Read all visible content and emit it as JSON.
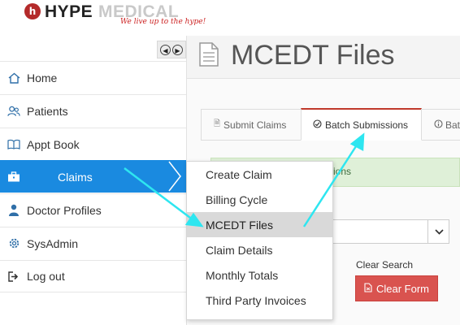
{
  "brand": {
    "logo_letter": "h",
    "name_first": "HYPE",
    "name_second": "MEDICAL",
    "tagline": "We live up to the hype!"
  },
  "sidebar": {
    "items": [
      {
        "label": "Home",
        "icon": "home-icon"
      },
      {
        "label": "Patients",
        "icon": "users-icon"
      },
      {
        "label": "Appt Book",
        "icon": "book-icon"
      },
      {
        "label": "Claims",
        "icon": "briefcase-icon",
        "active": true
      },
      {
        "label": "Doctor Profiles",
        "icon": "doctor-icon"
      },
      {
        "label": "SysAdmin",
        "icon": "gear-icon"
      },
      {
        "label": "Log out",
        "icon": "logout-icon"
      }
    ]
  },
  "claims_menu": {
    "items": [
      "Create Claim",
      "Billing Cycle",
      "MCEDT Files",
      "Claim Details",
      "Monthly Totals",
      "Third Party Invoices"
    ],
    "highlighted": "MCEDT Files"
  },
  "page": {
    "title": "MCEDT Files"
  },
  "tabs": [
    {
      "label": "Submit Claims",
      "icon": "file-icon"
    },
    {
      "label": "Batch Submissions",
      "icon": "check-circle-icon",
      "active": true
    },
    {
      "label": "Bat",
      "icon": "info-icon"
    }
  ],
  "alert": {
    "text": "ions"
  },
  "form": {
    "clear_search_label": "Clear Search",
    "clear_form_label": "Clear Form"
  },
  "colors": {
    "active_nav": "#1a8ae0",
    "annotation_arrow": "#2ee6f0",
    "clear_button": "#d9534f",
    "tab_accent": "#c0392b",
    "alert_bg": "#dff0d8"
  }
}
